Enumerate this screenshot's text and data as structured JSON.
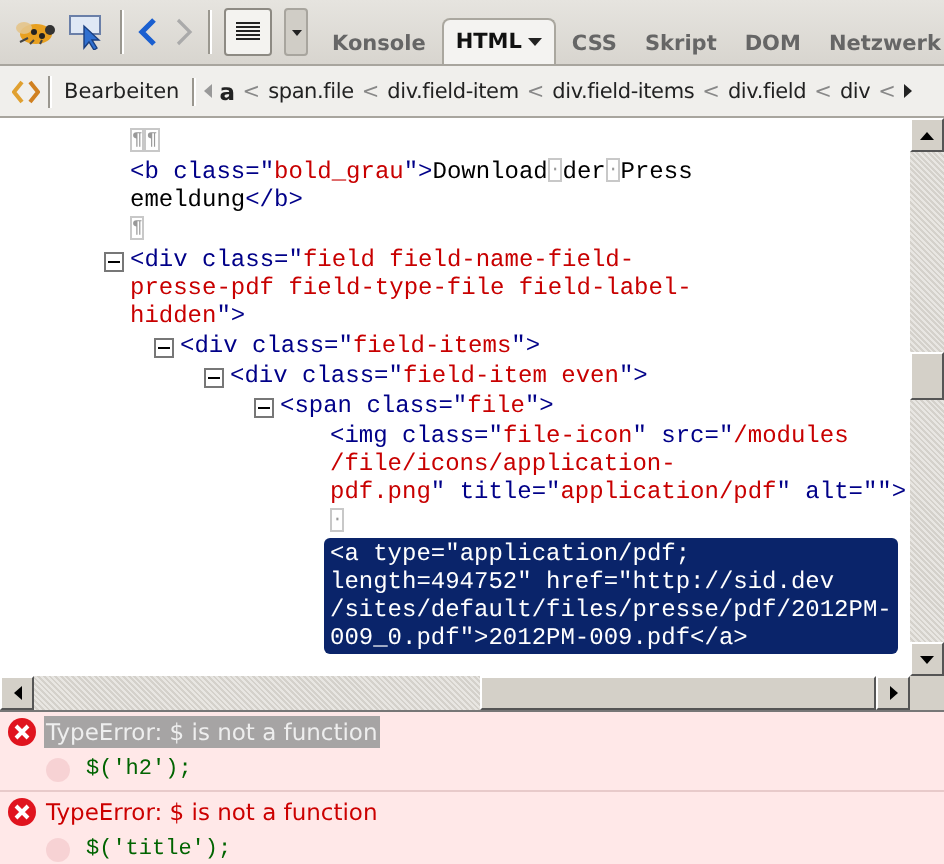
{
  "toolbar": {
    "back_disabled": false,
    "forward_disabled": true,
    "list_pressed": true
  },
  "tabs": [
    {
      "label": "Konsole",
      "selected": false
    },
    {
      "label": "HTML",
      "selected": true,
      "dropdown": true
    },
    {
      "label": "CSS",
      "selected": false
    },
    {
      "label": "Skript",
      "selected": false
    },
    {
      "label": "DOM",
      "selected": false
    },
    {
      "label": "Netzwerk",
      "selected": false
    }
  ],
  "breadcrumb_bar": {
    "edit_button": "Bearbeiten",
    "separator": "<",
    "crumbs": [
      {
        "label": "a",
        "selected": true
      },
      {
        "label": "span.file",
        "selected": false
      },
      {
        "label": "div.field-item",
        "selected": false
      },
      {
        "label": "div.field-items",
        "selected": false
      },
      {
        "label": "div.field",
        "selected": false
      },
      {
        "label": "div",
        "selected": false
      }
    ]
  },
  "html_tree": [
    {
      "lines": [
        "¶¶"
      ],
      "selected": false
    },
    {
      "lines": [
        "<b class=\"bold_grau\">Download·der·Press",
        "emeldung</b>"
      ],
      "selected": false
    },
    {
      "lines": [
        "¶"
      ],
      "selected": false
    },
    {
      "lines": [
        "<div class=\"field field-name-field-",
        "presse-pdf field-type-file field-label-",
        "hidden\">"
      ],
      "selected": false,
      "expanded": true,
      "children": [
        {
          "lines": [
            "<div class=\"field-items\">"
          ],
          "selected": false,
          "expanded": true,
          "children": [
            {
              "lines": [
                "<div class=\"field-item even\">"
              ],
              "selected": false,
              "expanded": true,
              "children": [
                {
                  "lines": [
                    "<span class=\"file\">"
                  ],
                  "selected": false,
                  "expanded": true,
                  "children": [
                    {
                      "lines": [
                        "<img class=\"file-icon\" src=\"/modules",
                        "/file/icons/application-",
                        "pdf.png\" title=\"application/pdf\" alt=\"\">"
                      ],
                      "selected": false
                    },
                    {
                      "lines": [
                        "·"
                      ],
                      "selected": false
                    },
                    {
                      "lines": [
                        "<a type=\"application/pdf;",
                        "length=494752\" href=\"http://sid.dev",
                        "/sites/default/files/presse/pdf/2012PM-",
                        "009_0.pdf\">2012PM-009.pdf</a>"
                      ],
                      "selected": true
                    }
                  ]
                }
              ]
            }
          ]
        }
      ]
    }
  ],
  "console": [
    {
      "message": "TypeError: $ is not a function",
      "code": "$('h2');",
      "selected": true
    },
    {
      "message": "TypeError: $ is not a function",
      "code": "$('title');",
      "selected": false
    }
  ]
}
